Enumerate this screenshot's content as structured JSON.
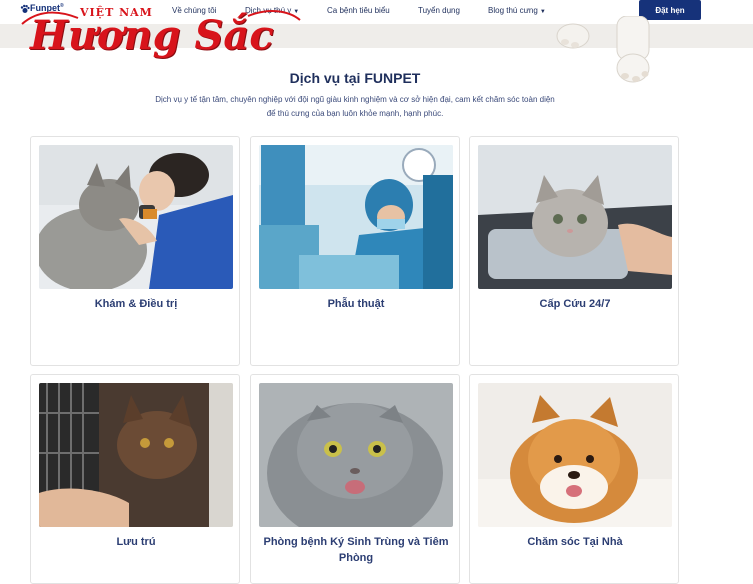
{
  "logo": {
    "brand": "Funpet",
    "registered": "®"
  },
  "watermark": {
    "line1": "VIỆT NAM",
    "line2": "Hương Sắc"
  },
  "nav": {
    "items": [
      {
        "label": "Về chúng tôi",
        "caret": false
      },
      {
        "label": "Dịch vụ thú y",
        "caret": true
      },
      {
        "label": "Ca bệnh tiêu biểu",
        "caret": false
      },
      {
        "label": "Tuyển dụng",
        "caret": false
      },
      {
        "label": "Blog thú cưng",
        "caret": true
      }
    ],
    "caret_icon": "chevron-down-icon",
    "cta": "Đặt hẹn"
  },
  "services": {
    "title": "Dịch vụ tại FUNPET",
    "description": "Dịch vụ y tế tận tâm, chuyên nghiệp với đội ngũ giàu kinh nghiệm và cơ sở hiện đại, cam kết chăm sóc toàn diện để thú cưng của bạn luôn khỏe mạnh, hạnh phúc.",
    "cards": [
      {
        "label": "Khám & Điều trị",
        "photo": "vet-examining-cat-photo"
      },
      {
        "label": "Phẫu thuật",
        "photo": "surgery-team-photo"
      },
      {
        "label": "Cấp Cứu 24/7",
        "photo": "kitten-in-carrier-photo"
      },
      {
        "label": "Lưu trú",
        "photo": "cat-in-crate-photo"
      },
      {
        "label": "Phòng bệnh Ký Sinh Trùng và Tiêm Phòng",
        "photo": "scottish-fold-cat-photo"
      },
      {
        "label": "Chăm sóc Tại Nhà",
        "photo": "shiba-puppy-photo"
      }
    ]
  },
  "colors": {
    "navy": "#16327a",
    "heading": "#1f2f5c",
    "watermark_red": "#d8141b",
    "hero_bg": "#efedea"
  }
}
